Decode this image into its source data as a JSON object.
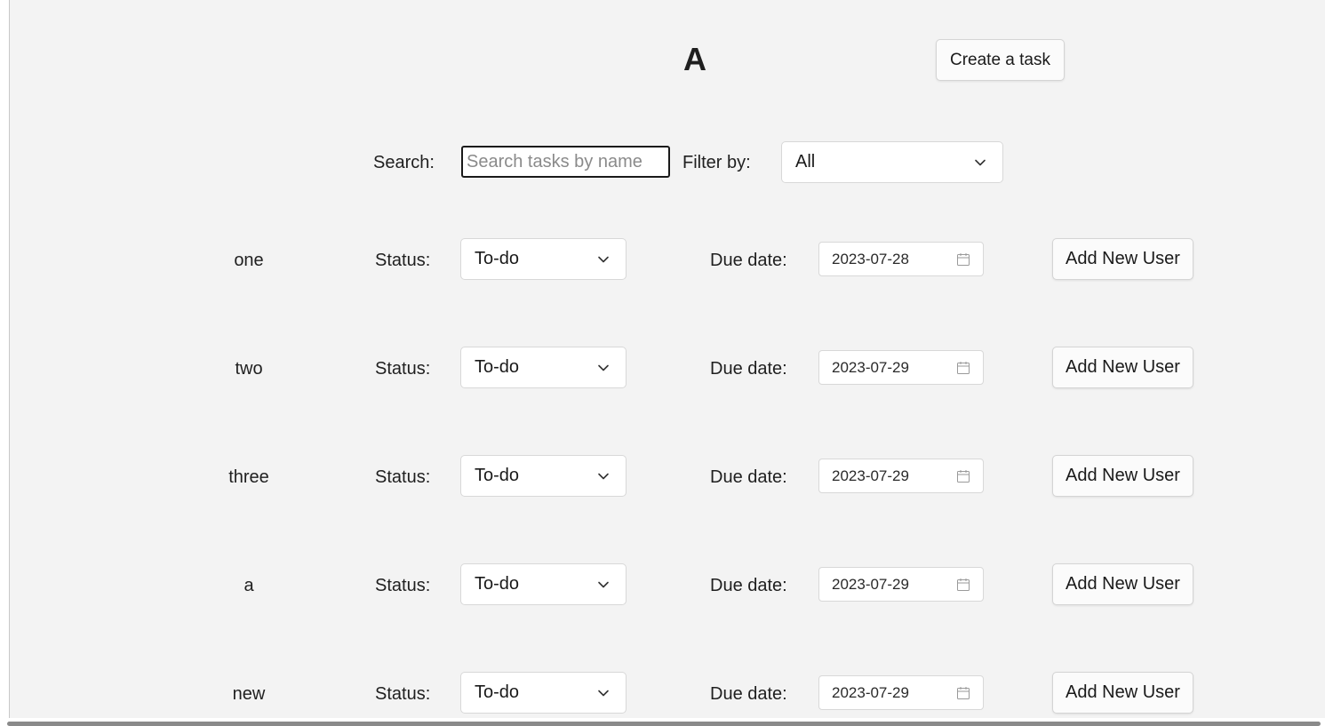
{
  "header": {
    "title": "A",
    "create_button_label": "Create a task"
  },
  "toolbar": {
    "search_label": "Search:",
    "search_placeholder": "Search tasks by name",
    "search_value": "",
    "filter_label": "Filter by:",
    "filter_value": "All"
  },
  "tasks": [
    {
      "name": "one",
      "status_label": "Status:",
      "status": "To-do",
      "due_label": "Due date:",
      "due_date": "2023-07-28",
      "action_label": "Add New User"
    },
    {
      "name": "two",
      "status_label": "Status:",
      "status": "To-do",
      "due_label": "Due date:",
      "due_date": "2023-07-29",
      "action_label": "Add New User"
    },
    {
      "name": "three",
      "status_label": "Status:",
      "status": "To-do",
      "due_label": "Due date:",
      "due_date": "2023-07-29",
      "action_label": "Add New User"
    },
    {
      "name": "a",
      "status_label": "Status:",
      "status": "To-do",
      "due_label": "Due date:",
      "due_date": "2023-07-29",
      "action_label": "Add New User"
    },
    {
      "name": "new",
      "status_label": "Status:",
      "status": "To-do",
      "due_label": "Due date:",
      "due_date": "2023-07-29",
      "action_label": "Add New User"
    }
  ],
  "icons": {
    "dropdown": "chevron-down-icon",
    "date": "calendar-icon"
  },
  "colors": {
    "background": "#f3f3f3",
    "control_background": "#ffffff",
    "border": "#d8d8d8",
    "focus_border": "#1a1a1a"
  }
}
